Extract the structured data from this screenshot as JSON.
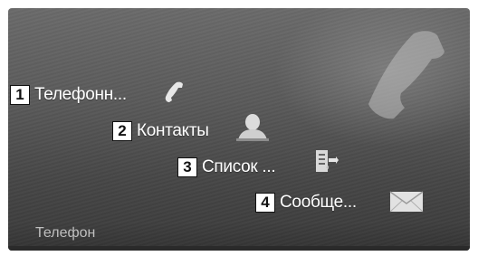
{
  "menu": {
    "items": [
      {
        "number": "1",
        "label": "Телефонн...",
        "icon": "phone-handset-icon"
      },
      {
        "number": "2",
        "label": "Контакты",
        "icon": "contact-person-icon"
      },
      {
        "number": "3",
        "label": "Список ...",
        "icon": "call-list-icon"
      },
      {
        "number": "4",
        "label": "Сообще...",
        "icon": "envelope-icon"
      }
    ]
  },
  "footer": {
    "title": "Телефон"
  },
  "background_icon": "large-phone-handset-icon"
}
